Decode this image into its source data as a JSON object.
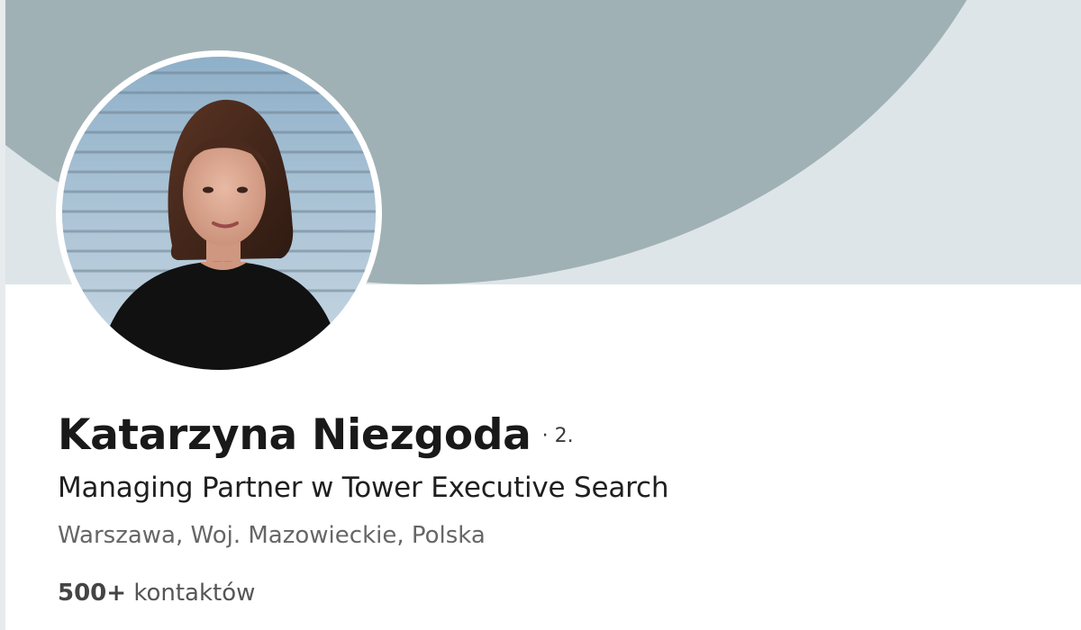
{
  "profile": {
    "name": "Katarzyna Niezgoda",
    "connection_degree": "· 2.",
    "headline": "Managing Partner w Tower Executive Search",
    "location": "Warszawa, Woj. Mazowieckie, Polska",
    "connections_count": "500+",
    "connections_label": "kontaktów"
  },
  "colors": {
    "cover_primary": "#a0b1b5",
    "cover_secondary": "#dde5e8",
    "background": "#ffffff"
  },
  "icons": {
    "avatar": "profile-photo"
  }
}
